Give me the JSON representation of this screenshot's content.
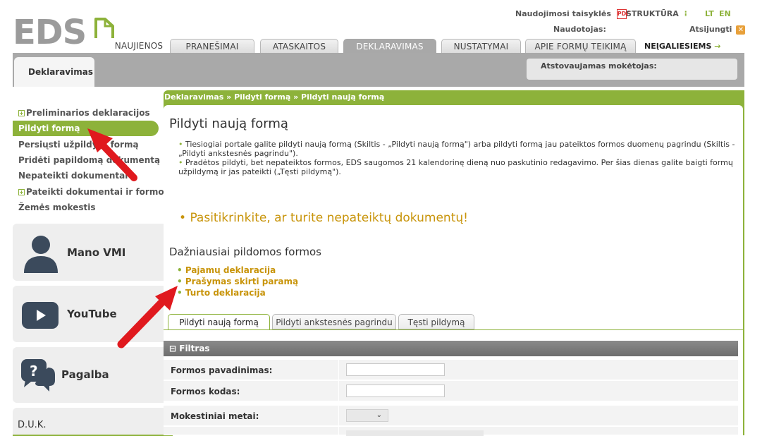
{
  "header": {
    "logo_text": "EDS",
    "top_links": {
      "rules": "Naudojimosi taisyklės",
      "structure": "STRUKTŪRA",
      "lang_lt": "LT",
      "lang_en": "EN",
      "user_label": "Naudotojas:",
      "logout": "Atsijungti"
    },
    "tabs": [
      "NAUJIENOS",
      "PRANEŠIMAI",
      "ATASKAITOS",
      "DEKLARAVIMAS",
      "NUSTATYMAI",
      "APIE FORMŲ TEIKIMĄ"
    ],
    "accessibility": "NEĮGALIESIEMS",
    "section_tab": "Deklaravimas",
    "represented_payer": "Atstovaujamas mokėtojas:"
  },
  "sidebar": {
    "items": [
      "Preliminarios deklaracijos",
      "Pildyti formą",
      "Persiųsti užpildytą formą",
      "Pridėti papildomą dokumentą",
      "Nepateikti dokumentai",
      "Pateikti dokumentai ir formos",
      "Žemės mokestis"
    ],
    "cards": {
      "vmi": "Mano VMI",
      "youtube": "YouTube",
      "help": "Pagalba",
      "faq": "D.U.K."
    }
  },
  "main": {
    "breadcrumb": "Deklaravimas » Pildyti formą » Pildyti naują formą",
    "title": "Pildyti naują formą",
    "bullets": [
      "Tiesiogiai portale galite pildyti naują formą (Skiltis - „Pildyti naują formą\") arba pildyti formą jau pateiktos formos duomenų pagrindu (Skiltis - „Pildyti ankstesnės pagrindu\").",
      "Pradėtos pildyti, bet nepateiktos formos, EDS saugomos 21 kalendorinę dieną nuo paskutinio redagavimo. Per šias dienas galite baigti formų užpildymą ir jas pateikti („Tęsti pildymą\")."
    ],
    "warning": "Pasitikrinkite, ar turite nepateiktų dokumentų!",
    "frequent_title": "Dažniausiai pildomos formos",
    "frequent_forms": [
      "Pajamų deklaracija",
      "Prašymas skirti paramą",
      "Turto deklaracija"
    ],
    "form_tabs": [
      "Pildyti naują formą",
      "Pildyti ankstesnės pagrindu",
      "Tęsti pildymą"
    ],
    "filter": {
      "title": "Filtras",
      "fields": [
        "Formos pavadinimas:",
        "Formos kodas:",
        "Mokestiniai metai:"
      ],
      "select_arrow": "⌄"
    }
  },
  "colors": {
    "brand_green": "#8db23a",
    "link_gold": "#c8940a",
    "annotation_red": "#e0191e"
  }
}
